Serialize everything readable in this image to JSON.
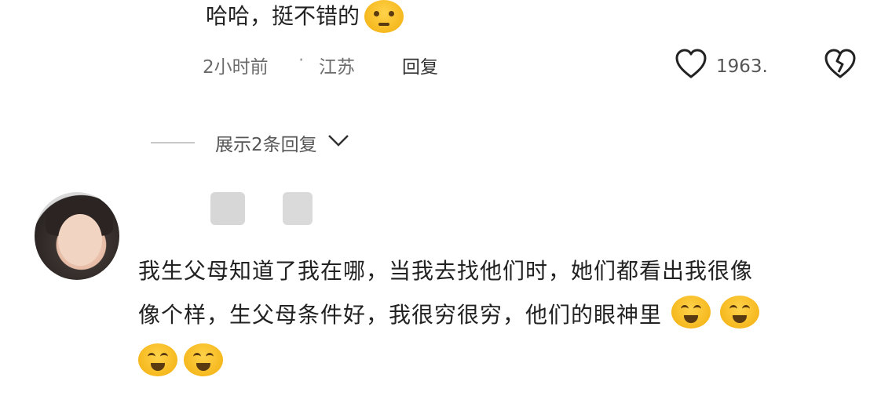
{
  "parent_comment": {
    "text_tail": "哈哈，挺不错的",
    "time": "2小时前",
    "separator": "·",
    "location": "江苏",
    "reply_label": "回复",
    "like_count": "1963."
  },
  "expand_replies_label": "展示2条回复",
  "comment": {
    "text_part1": "我生父母知道了我在哪，当我去找他们时，她们都看出我很像",
    "text_part2": "像个样，生父母条件好，我很穷很穷，他们的眼神里"
  },
  "icons": [
    "heart-icon",
    "broken-heart-icon",
    "chevron-down-icon",
    "emoji-icon"
  ],
  "colors": {
    "accent": "#f6b91f",
    "text": "#222222",
    "meta": "#6b6b6b"
  }
}
